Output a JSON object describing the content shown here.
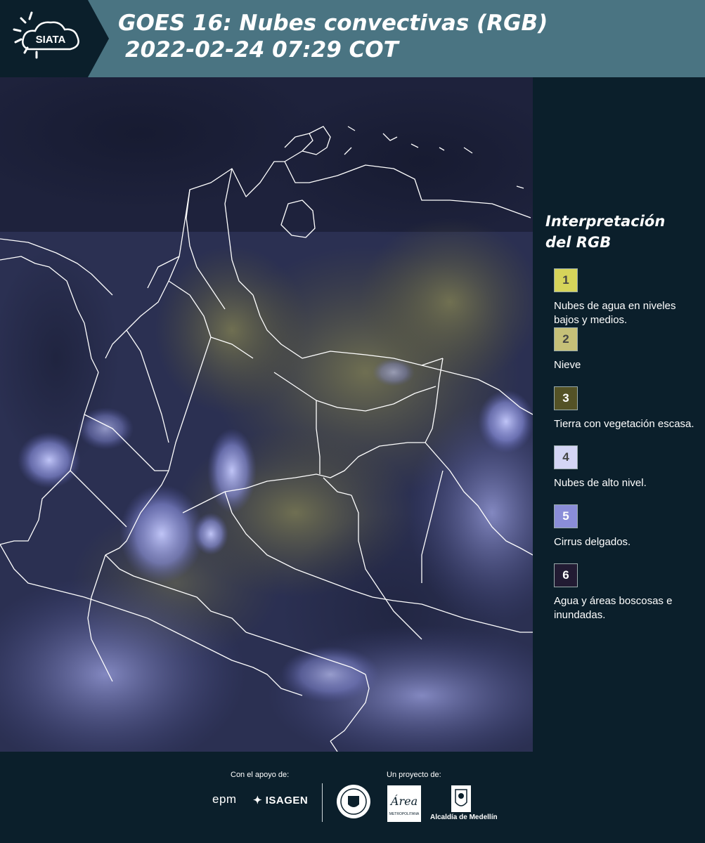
{
  "header": {
    "logo_text": "SIATA",
    "title_line1": "GOES 16: Nubes convectivas (RGB)",
    "title_line2": "2022-02-24 07:29 COT"
  },
  "map": {
    "description_colors": {
      "background": "#2a3050",
      "cloud_high": "#b8bff5",
      "land_yellow": "#6a6a48",
      "borders": "#ffffff"
    }
  },
  "legend": {
    "title_line1": "Interpretación",
    "title_line2": "del RGB",
    "items": [
      {
        "number": "1",
        "label": "Nubes de agua en niveles bajos y medios.",
        "color": "#d6d45a"
      },
      {
        "number": "2",
        "label": "Nieve",
        "color": "#c6c078"
      },
      {
        "number": "3",
        "label": "Tierra con vegetación escasa.",
        "color": "#545226"
      },
      {
        "number": "4",
        "label": "Nubes de alto nivel.",
        "color": "#d4d5f5"
      },
      {
        "number": "5",
        "label": "Cirrus delgados.",
        "color": "#8a8dd8"
      },
      {
        "number": "6",
        "label": "Agua y áreas boscosas e inundadas.",
        "color": "#221b33"
      }
    ]
  },
  "footer": {
    "support_label": "Con el apoyo de:",
    "project_label": "Un proyecto de:",
    "partner1": "epm",
    "partner2": "ISAGEN",
    "alcaldia": "Alcaldía de Medellín",
    "area_text": "Área",
    "area_sub": "METROPOLITANA"
  }
}
